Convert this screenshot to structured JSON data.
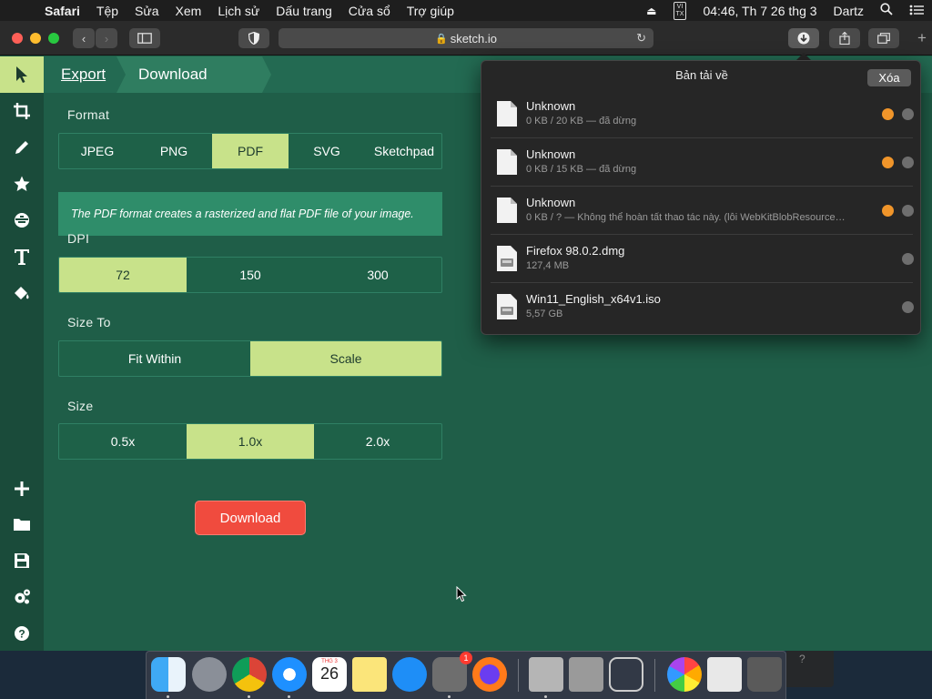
{
  "menubar": {
    "app_name": "Safari",
    "items": [
      "Tệp",
      "Sửa",
      "Xem",
      "Lịch sử",
      "Dấu trang",
      "Cửa sổ",
      "Trợ giúp"
    ],
    "input_badge_top": "VI",
    "input_badge_bottom": "TX",
    "clock": "04:46, Th 7 26 thg 3",
    "user": "Dartz"
  },
  "browser": {
    "url": "sketch.io"
  },
  "app": {
    "breadcrumb_export": "Export",
    "breadcrumb_download": "Download",
    "format_label": "Format",
    "format_options": [
      "JPEG",
      "PNG",
      "PDF",
      "SVG",
      "Sketchpad"
    ],
    "format_selected": "PDF",
    "format_note": "The PDF format creates a rasterized and flat PDF file of your image.",
    "dpi_label": "DPI",
    "dpi_options": [
      "72",
      "150",
      "300"
    ],
    "dpi_selected": "72",
    "sizeto_label": "Size To",
    "sizeto_options": [
      "Fit Within",
      "Scale"
    ],
    "sizeto_selected": "Scale",
    "size_label": "Size",
    "size_options": [
      "0.5x",
      "1.0x",
      "2.0x"
    ],
    "size_selected": "1.0x",
    "download_button": "Download",
    "colors": {
      "panel": "#1f5e48",
      "selected": "#c8e28a",
      "download": "#f04b3e"
    }
  },
  "downloads": {
    "title": "Bản tải về",
    "clear_button": "Xóa",
    "items": [
      {
        "name": "Unknown",
        "status": "0 KB / 20 KB — đã dừng",
        "icon": "blank-file-icon",
        "retry": true
      },
      {
        "name": "Unknown",
        "status": "0 KB / 15 KB — đã dừng",
        "icon": "blank-file-icon",
        "retry": true
      },
      {
        "name": "Unknown",
        "status": "0 KB / ? — Không thể hoàn tất thao tác này. (lỗi WebKitBlobResource…",
        "icon": "blank-file-icon",
        "retry": true
      },
      {
        "name": "Firefox 98.0.2.dmg",
        "status": "127,4 MB",
        "icon": "disk-image-icon",
        "retry": false
      },
      {
        "name": "Win11_English_x64v1.iso",
        "status": "5,57 GB",
        "icon": "disk-image-icon",
        "retry": false
      }
    ]
  },
  "dock": {
    "calendar_month": "THG 3",
    "calendar_day": "26",
    "settings_badge": "1",
    "apps": [
      "finder-icon",
      "launchpad-icon",
      "chrome-icon",
      "safari-icon",
      "calendar-icon",
      "notes-icon",
      "app-store-icon",
      "system-preferences-icon",
      "firefox-icon",
      "disk-utility-icon",
      "system-information-icon",
      "directory-utility-icon",
      "photos-icon",
      "preview-icon",
      "trash-icon"
    ]
  }
}
